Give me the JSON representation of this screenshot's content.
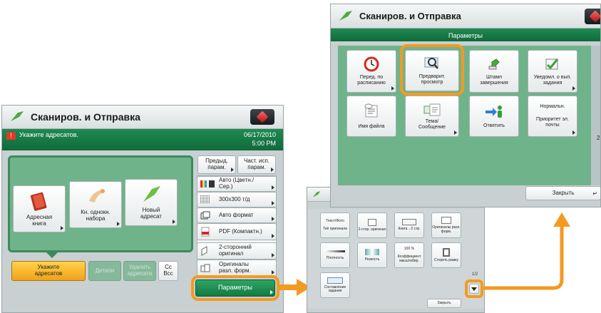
{
  "colors": {
    "accent": "#f39a21",
    "green": "#168a4c",
    "panel": "#6fb38a"
  },
  "left": {
    "title": "Сканиров. и Отправка",
    "prompt": "Укажите адресатов.",
    "date": "06/17/2010",
    "time": "5:00 PM",
    "tiles": [
      {
        "label": "Адресная книга",
        "icon": "address-book-icon"
      },
      {
        "label": "Кн. однокн. набора",
        "icon": "one-touch-hand-icon"
      },
      {
        "label": "Новый адресат",
        "icon": "new-address-plane-icon"
      }
    ],
    "bottom": {
      "specify": "Укажите адресатов",
      "details": "Детали",
      "delete": "Удалить адресата",
      "cc": "Cc Bcc"
    },
    "top_buttons": [
      "Предыд. парам.",
      "Част. исп. парам."
    ],
    "settings": [
      {
        "label": "Авто (Цветн./Сер.)",
        "icon": "color-mode-icon"
      },
      {
        "label": "300x300 т/д",
        "icon": "resolution-icon"
      },
      {
        "label": "Авто формат",
        "icon": "scan-size-icon"
      },
      {
        "label": "PDF (Компактн.)",
        "icon": "pdf-icon"
      },
      {
        "label": "2-сторонний оригинал",
        "icon": "two-sided-icon"
      },
      {
        "label": "Оригиналы разл. форм.",
        "icon": "different-size-icon"
      }
    ],
    "options_button": "Параметры"
  },
  "middle": {
    "rows": [
      [
        {
          "label": "Текст/Фото"
        },
        {
          "label": "Тип оригинала"
        },
        {
          "label": "2-стор. оригинал"
        },
        {
          "label": "Книга→2 стр."
        },
        {
          "label": "Оригиналы разл. форм."
        }
      ],
      [
        {
          "label": "Плотность"
        },
        {
          "label": "Резкость"
        },
        {
          "label": "100 %"
        },
        {
          "label": "Коэффициент масштабир."
        },
        {
          "label": "Стереть рамку"
        }
      ],
      [
        {
          "label": "Составление задания"
        }
      ]
    ],
    "page": "1/2",
    "close": "Закрыть"
  },
  "right": {
    "title": "Сканиров. и Отправка",
    "band": "Параметры",
    "row1": [
      {
        "label": "Перед. по расписанию",
        "icon": "clock-icon"
      },
      {
        "label": "Предварит. просмотр",
        "icon": "preview-magnifier-icon"
      },
      {
        "label": "Штамп завершения",
        "icon": "stamp-icon"
      },
      {
        "label": "Уведомл. о вып. задания",
        "icon": "notify-checkmark-icon"
      }
    ],
    "row2": [
      {
        "label": "Имя файла",
        "icon": "file-name-icon"
      },
      {
        "label": "Тема/ Сообщение",
        "icon": "subject-message-icon"
      },
      {
        "label": "Ответить",
        "icon": "reply-person-icon"
      },
      {
        "label": "Приоритет эл. почты",
        "value": "Нормальн."
      }
    ],
    "page_hint": "2",
    "close": "Закрыть"
  }
}
